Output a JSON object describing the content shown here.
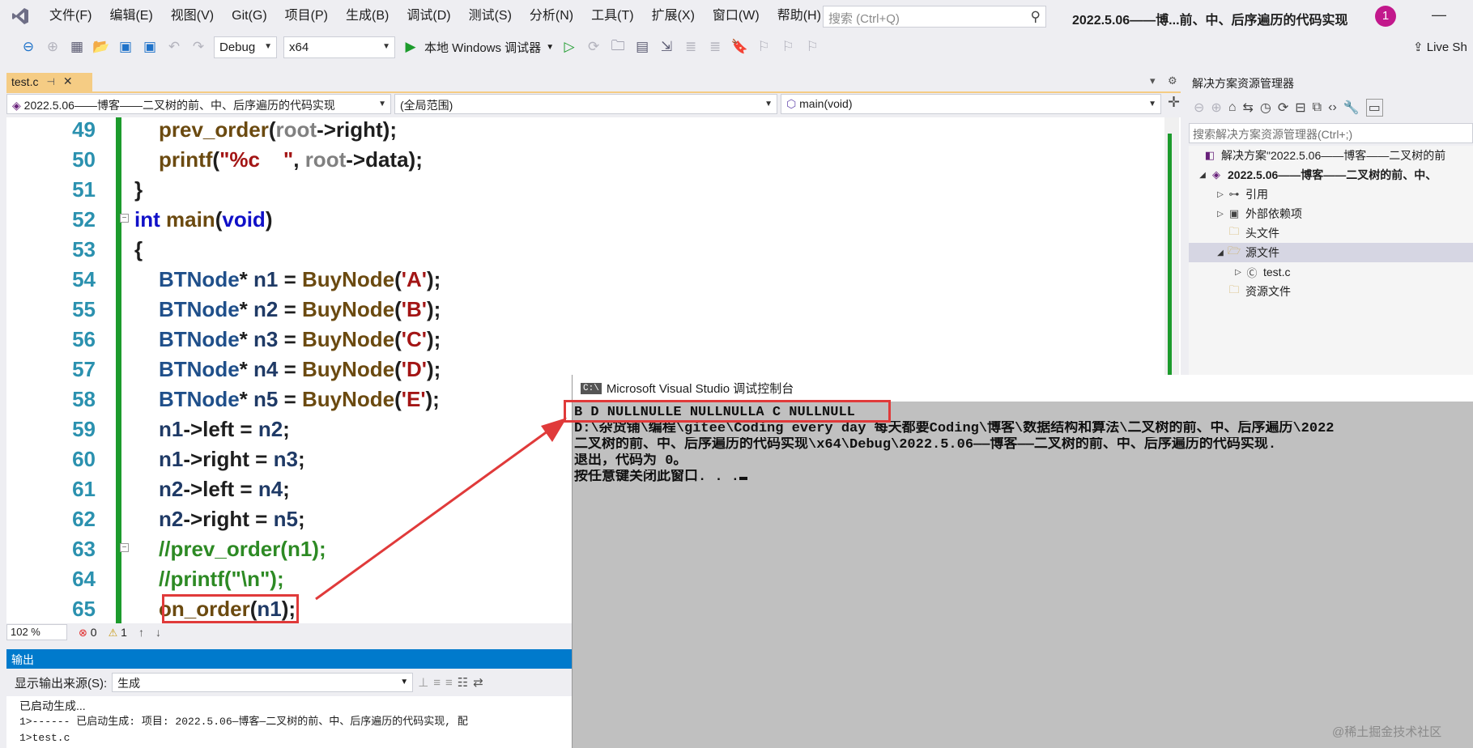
{
  "menu": {
    "items": [
      "文件(F)",
      "编辑(E)",
      "视图(V)",
      "Git(G)",
      "项目(P)",
      "生成(B)",
      "调试(D)",
      "测试(S)",
      "分析(N)",
      "工具(T)",
      "扩展(X)",
      "窗口(W)",
      "帮助(H)"
    ],
    "search_placeholder": "搜索 (Ctrl+Q)",
    "window_title": "2022.5.06——博...前、中、后序遍历的代码实现",
    "badge": "1"
  },
  "toolbar": {
    "config": "Debug",
    "platform": "x64",
    "run_label": "本地 Windows 调试器",
    "live_share": "Live Sh"
  },
  "editor": {
    "tab_label": "test.c",
    "nav_project": "2022.5.06——博客——二叉树的前、中、后序遍历的代码实现",
    "nav_scope": "(全局范围)",
    "nav_member": "main(void)",
    "line_numbers": [
      "49",
      "50",
      "51",
      "52",
      "53",
      "54",
      "55",
      "56",
      "57",
      "58",
      "59",
      "60",
      "61",
      "62",
      "63",
      "64",
      "65"
    ],
    "zoom": "102 %",
    "errors": "0",
    "warnings": "1"
  },
  "output": {
    "title": "输出",
    "source_label": "显示输出来源(S):",
    "source_value": "生成",
    "lines": [
      "已启动生成...",
      "1>------ 已启动生成: 项目: 2022.5.06—博客—二叉树的前、中、后序遍历的代码实现, 配",
      "1>test.c"
    ]
  },
  "solution_explorer": {
    "title": "解决方案资源管理器",
    "search_placeholder": "搜索解决方案资源管理器(Ctrl+;)",
    "items": [
      {
        "label": "解决方案\"2022.5.06——博客——二叉树的前",
        "icon": "solution-icon"
      },
      {
        "label": "2022.5.06——博客——二叉树的前、中、",
        "icon": "project-icon"
      },
      {
        "label": "引用",
        "icon": "references-icon"
      },
      {
        "label": "外部依赖项",
        "icon": "external-deps-icon"
      },
      {
        "label": "头文件",
        "icon": "folder-icon"
      },
      {
        "label": "源文件",
        "icon": "folder-open-icon"
      },
      {
        "label": "test.c",
        "icon": "c-file-icon"
      },
      {
        "label": "资源文件",
        "icon": "folder-icon"
      }
    ]
  },
  "console": {
    "title": "Microsoft Visual Studio 调试控制台",
    "lines": [
      "B D NULLNULLE NULLNULLA C NULLNULL",
      "D:\\杂货铺\\编程\\gitee\\Coding every day 每天都要Coding\\博客\\数据结构和算法\\二叉树的前、中、后序遍历\\2022",
      "二叉树的前、中、后序遍历的代码实现\\x64\\Debug\\2022.5.06——博客——二叉树的前、中、后序遍历的代码实现.",
      "退出，代码为 0。",
      "按任意键关闭此窗口. . ."
    ]
  },
  "watermark": "@稀土掘金技术社区",
  "colors": {
    "accent": "#007acc",
    "highlight_red": "#e03a3a",
    "tab_active": "#f5cc84",
    "change_bar": "#1c9b2c"
  }
}
